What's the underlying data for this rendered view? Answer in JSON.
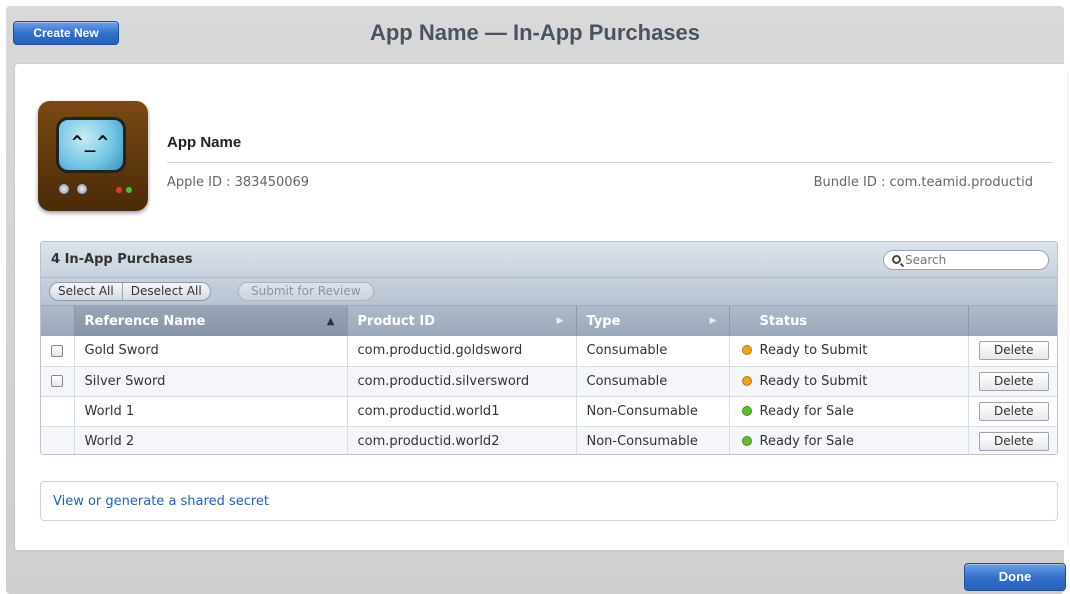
{
  "header": {
    "title": "App Name — In-App Purchases",
    "create_label": "Create New"
  },
  "app": {
    "name": "App Name",
    "apple_id": "Apple ID : 383450069",
    "bundle_id": "Bundle ID : com.teamid.productid",
    "icon_face": "^_^"
  },
  "table": {
    "count_label": "4 In-App Purchases",
    "search_placeholder": "Search",
    "select_all_label": "Select All",
    "deselect_all_label": "Deselect All",
    "submit_label": "Submit for Review",
    "columns": [
      "Reference Name",
      "Product ID",
      "Type",
      "Status"
    ],
    "rows": [
      {
        "name": "Gold Sword",
        "product_id": "com.productid.goldsword",
        "type": "Consumable",
        "status": "Ready to Submit",
        "status_color": "#f2a21c",
        "checkbox": true,
        "action": "Delete"
      },
      {
        "name": "Silver Sword",
        "product_id": "com.productid.silversword",
        "type": "Consumable",
        "status": "Ready to Submit",
        "status_color": "#f2a21c",
        "checkbox": true,
        "action": "Delete"
      },
      {
        "name": "World 1",
        "product_id": "com.productid.world1",
        "type": "Non-Consumable",
        "status": "Ready for Sale",
        "status_color": "#5cbf2a",
        "checkbox": false,
        "action": "Delete"
      },
      {
        "name": "World 2",
        "product_id": "com.productid.world2",
        "type": "Non-Consumable",
        "status": "Ready for Sale",
        "status_color": "#5cbf2a",
        "checkbox": false,
        "action": "Delete"
      }
    ]
  },
  "secret": {
    "link_label": "View or generate a shared secret"
  },
  "footer": {
    "done_label": "Done"
  },
  "colors": {
    "accent_blue": "#2f6ec9",
    "link_blue": "#1e63b5",
    "status_pending": "#f2a21c",
    "status_ready": "#5cbf2a"
  }
}
